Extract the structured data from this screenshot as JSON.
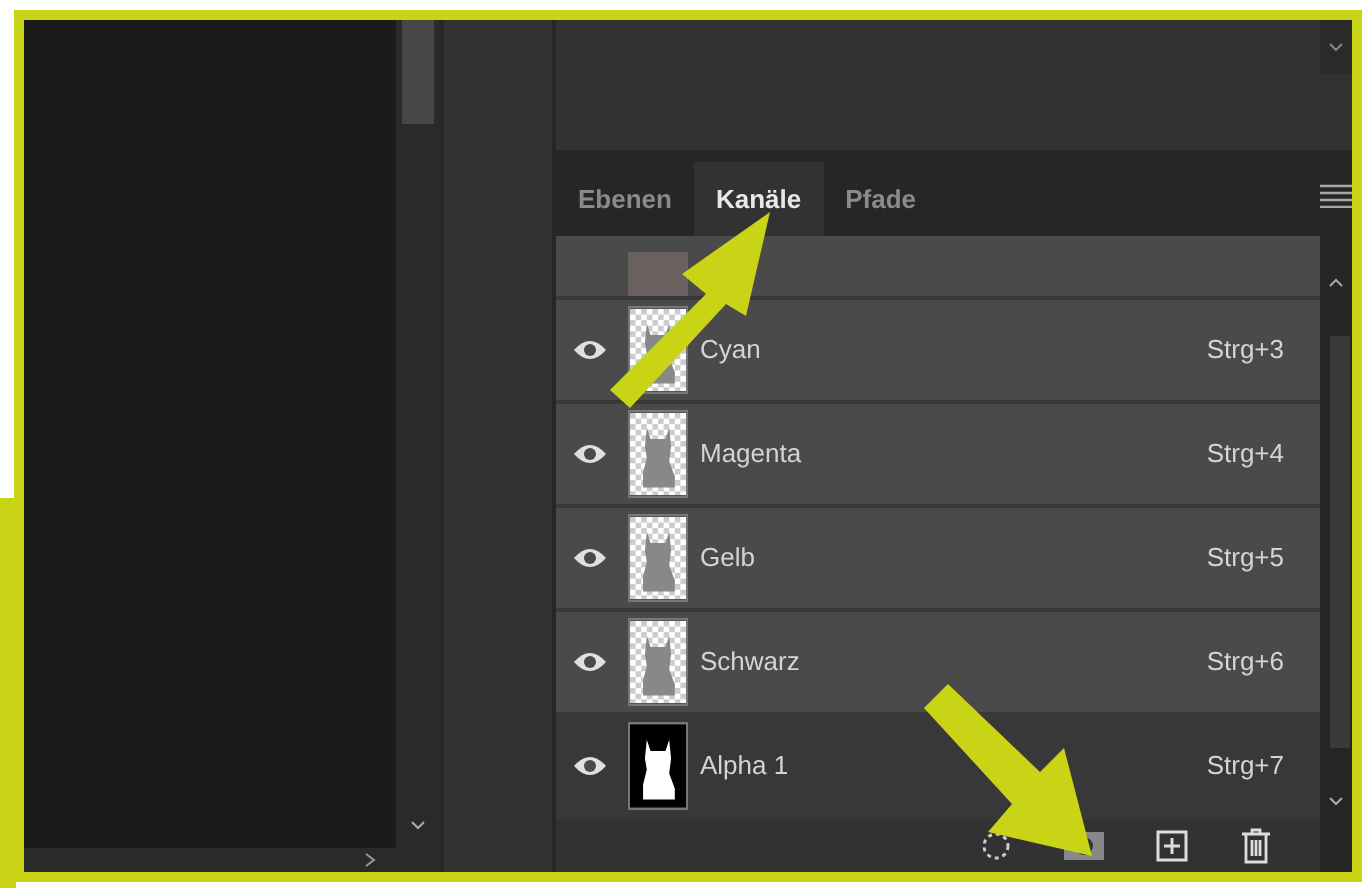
{
  "tabs": [
    {
      "label": "Ebenen",
      "selected": false
    },
    {
      "label": "Kanäle",
      "selected": true
    },
    {
      "label": "Pfade",
      "selected": false
    }
  ],
  "channels": [
    {
      "name": "Cyan",
      "shortcut": "Strg+3",
      "visible": true,
      "selected": true,
      "kind": "photo"
    },
    {
      "name": "Magenta",
      "shortcut": "Strg+4",
      "visible": true,
      "selected": true,
      "kind": "photo"
    },
    {
      "name": "Gelb",
      "shortcut": "Strg+5",
      "visible": true,
      "selected": true,
      "kind": "photo"
    },
    {
      "name": "Schwarz",
      "shortcut": "Strg+6",
      "visible": true,
      "selected": true,
      "kind": "photo"
    },
    {
      "name": "Alpha 1",
      "shortcut": "Strg+7",
      "visible": true,
      "selected": false,
      "kind": "mask"
    }
  ]
}
